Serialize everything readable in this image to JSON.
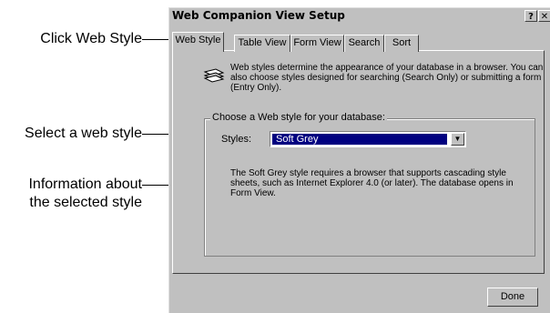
{
  "callouts": {
    "click_web_style": "Click Web Style",
    "select_web_style": "Select a web style",
    "info_line1": "Information about",
    "info_line2": "the selected style"
  },
  "dialog": {
    "title": "Web Companion View Setup",
    "help_button": "?",
    "close_button": "✕",
    "tabs": [
      {
        "label": "Web Style",
        "active": true
      },
      {
        "label": "Table View",
        "active": false
      },
      {
        "label": "Form View",
        "active": false
      },
      {
        "label": "Search",
        "active": false
      },
      {
        "label": "Sort",
        "active": false
      }
    ],
    "description": "Web styles determine the appearance of your database in a browser. You can also choose styles designed for searching (Search Only) or submitting a form (Entry Only).",
    "group_label": "Choose a Web style for your database:",
    "styles_label": "Styles:",
    "styles_selected": "Soft Grey",
    "style_info": "The Soft Grey style requires a browser that supports cascading style sheets, such as Internet Explorer 4.0 (or later). The database opens in Form View.",
    "done_button": "Done"
  },
  "colors": {
    "dialog_face": "#c0c0c0",
    "selection": "#000080"
  }
}
